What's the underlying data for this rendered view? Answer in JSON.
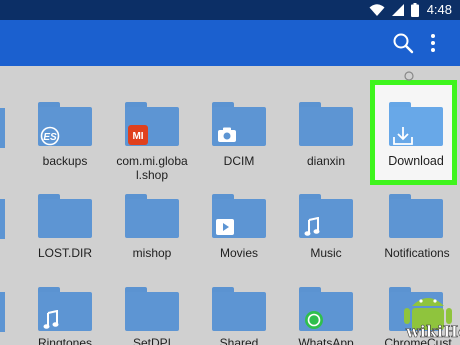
{
  "status": {
    "time": "4:48",
    "icons": [
      "wifi-icon",
      "signal-icon",
      "battery-icon"
    ]
  },
  "app_bar": {
    "color": "#1b60cf",
    "actions": [
      "search-icon",
      "more-vert-icon"
    ]
  },
  "folders": [
    {
      "name": "backups",
      "badge": "es-icon"
    },
    {
      "name": "com.mi.global.shop",
      "line1": "com.mi.globa",
      "line2": "l.shop",
      "badge": "mi-icon"
    },
    {
      "name": "DCIM",
      "badge": "camera-icon"
    },
    {
      "name": "dianxin",
      "badge": ""
    },
    {
      "name": "Download",
      "badge": "download-icon",
      "highlighted": true
    },
    {
      "name": "LOST.DIR",
      "badge": ""
    },
    {
      "name": "mishop",
      "badge": ""
    },
    {
      "name": "Movies",
      "badge": "play-icon"
    },
    {
      "name": "Music",
      "badge": "music-icon"
    },
    {
      "name": "Notifications",
      "badge": ""
    },
    {
      "name": "Ringtones",
      "badge": "music-icon"
    },
    {
      "name": "SetDPI",
      "badge": ""
    },
    {
      "name": "Shared",
      "badge": ""
    },
    {
      "name": "WhatsApp",
      "badge": "whatsapp-icon"
    },
    {
      "name": "ChromeCust",
      "badge": ""
    }
  ],
  "highlight_color": "#3ef51d",
  "watermark": {
    "text": "wikiHow"
  }
}
